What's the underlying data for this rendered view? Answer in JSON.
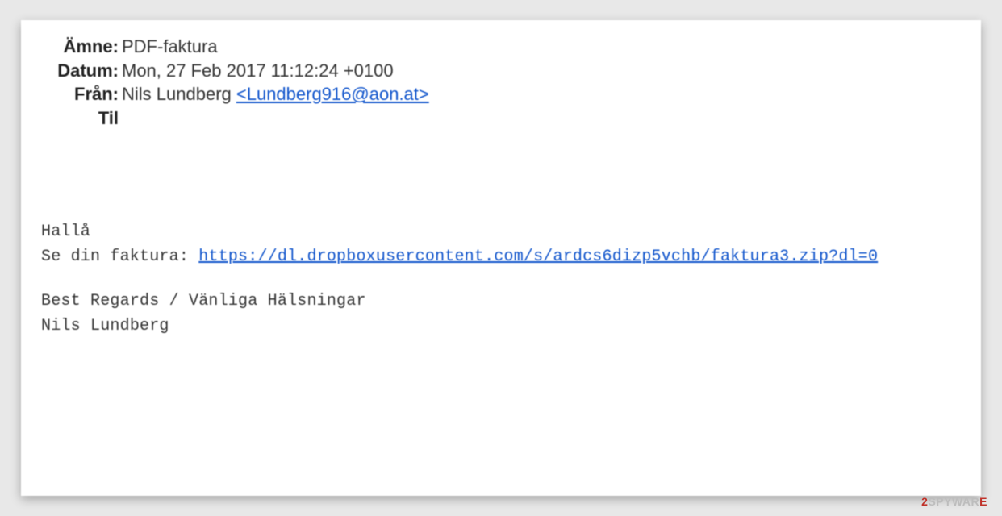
{
  "header": {
    "subject_label": "Ämne:",
    "subject_value": "PDF-faktura",
    "date_label": "Datum:",
    "date_value": "Mon, 27 Feb 2017 11:12:24 +0100",
    "from_label": "Från:",
    "from_name": "Nils Lundberg ",
    "from_email": "<Lundberg916@aon.at>",
    "to_label": "Til"
  },
  "body": {
    "greeting": "Hallå",
    "invoice_prefix": "Se din faktura: ",
    "invoice_link": "https://dl.dropboxusercontent.com/s/ardcs6dizp5vchb/faktura3.zip?dl=0",
    "regards": "Best Regards / Vänliga Hälsningar",
    "signature": "Nils Lundberg"
  },
  "watermark": {
    "digit": "2",
    "text1": "SPYWAR",
    "text2": "E"
  }
}
